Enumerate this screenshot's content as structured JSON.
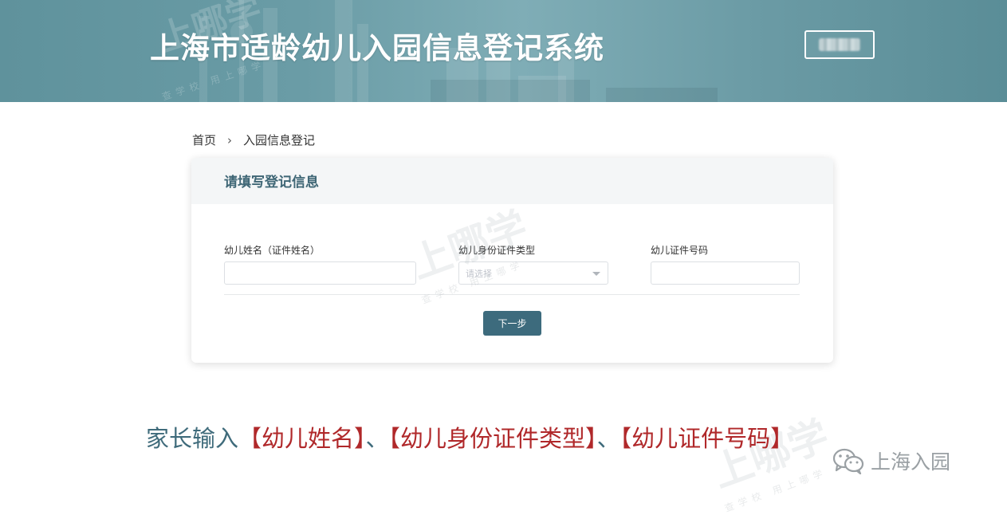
{
  "header": {
    "title": "上海市适龄幼儿入园信息登记系统",
    "login_button_label": ""
  },
  "breadcrumb": {
    "home": "首页",
    "separator": "›",
    "current": "入园信息登记"
  },
  "form": {
    "title": "请填写登记信息",
    "fields": [
      {
        "label": "幼儿姓名（证件姓名）",
        "value": "",
        "placeholder": ""
      },
      {
        "label": "幼儿身份证件类型",
        "value": "",
        "placeholder": "请选择"
      },
      {
        "label": "幼儿证件号码",
        "value": "",
        "placeholder": ""
      }
    ],
    "next_button": "下一步"
  },
  "caption": {
    "lead": "家长输入",
    "item1": "【幼儿姓名】",
    "sep1": "、",
    "item2": "【幼儿身份证件类型】",
    "sep2": "、",
    "item3": "【幼儿证件号码】"
  },
  "watermark": {
    "brand": "上哪学",
    "sub": "查学校 用上哪学"
  },
  "wechat": {
    "icon": "wechat-icon",
    "account": "上海入园"
  },
  "colors": {
    "banner": "#6a9ca6",
    "primary_button": "#3d6b7d",
    "caption_lead": "#3f6b7b",
    "caption_highlight": "#b0282a",
    "form_title": "#3e6675"
  }
}
